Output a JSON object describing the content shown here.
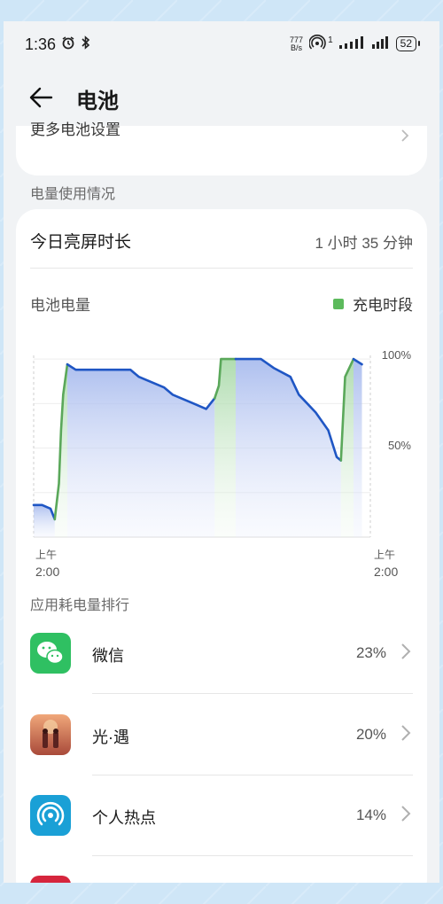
{
  "status_bar": {
    "time": "1:36",
    "net_speed_value": "777",
    "net_speed_unit": "B/s",
    "hotspot_count": "1",
    "battery": "52"
  },
  "header": {
    "title": "电池"
  },
  "top_card": {
    "cut_text": "更多电池设置"
  },
  "section_usage": "电量使用情况",
  "screen_time": {
    "label": "今日亮屏时长",
    "value": "1 小时 35 分钟"
  },
  "battery_level_label": "电池电量",
  "legend_charging": "充电时段",
  "chart_data": {
    "type": "area",
    "y_ticks": [
      "100%",
      "50%"
    ],
    "ylim": [
      0,
      100
    ],
    "x_labels": [
      {
        "top": "上午",
        "bottom": "2:00"
      },
      {
        "top": "上午",
        "bottom": "2:00"
      }
    ],
    "colors": {
      "discharge_line": "#1f56c4",
      "charge_line": "#5aa85a",
      "legend": "#5cba5c"
    },
    "x": [
      0,
      2,
      4,
      5,
      6,
      6.5,
      7,
      8,
      10,
      12,
      14,
      17,
      19,
      20,
      23,
      24,
      25,
      26,
      31,
      33,
      38,
      41,
      43,
      44,
      44.5,
      47,
      48,
      52,
      54,
      57,
      61,
      63,
      65,
      67,
      70,
      72,
      73,
      74,
      76,
      78
    ],
    "y": [
      18,
      18,
      16,
      10,
      30,
      60,
      80,
      97,
      94,
      94,
      94,
      94,
      94,
      94,
      94,
      92,
      90,
      89,
      84,
      80,
      75,
      72,
      78,
      85,
      100,
      100,
      100,
      100,
      100,
      95,
      90,
      80,
      75,
      70,
      60,
      45,
      43,
      90,
      100,
      97
    ],
    "segments": [
      {
        "type": "discharge",
        "from": 0,
        "to": 5
      },
      {
        "type": "charge",
        "from": 5,
        "to": 8
      },
      {
        "type": "discharge",
        "from": 8,
        "to": 43
      },
      {
        "type": "charge",
        "from": 43,
        "to": 48
      },
      {
        "type": "discharge",
        "from": 48,
        "to": 73
      },
      {
        "type": "charge",
        "from": 73,
        "to": 76
      },
      {
        "type": "discharge",
        "from": 76,
        "to": 80
      }
    ]
  },
  "section_app_rank": "应用耗电量排行",
  "apps": [
    {
      "name": "微信",
      "percent": "23%",
      "icon": "wechat-icon"
    },
    {
      "name": "光·遇",
      "percent": "20%",
      "icon": "sky-game-icon"
    },
    {
      "name": "个人热点",
      "percent": "14%",
      "icon": "hotspot-icon"
    },
    {
      "name": "",
      "percent": "",
      "icon": "app-icon-red"
    }
  ]
}
